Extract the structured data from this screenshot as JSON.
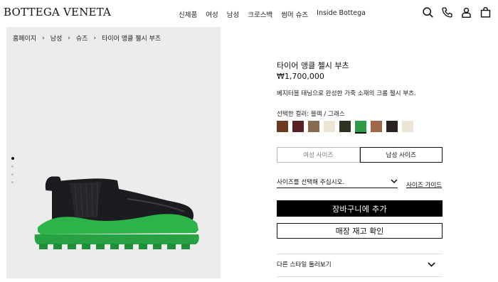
{
  "header": {
    "logo": "BOTTEGA VENETA",
    "nav": [
      "신제품",
      "여성",
      "남성",
      "크로스백",
      "썸머 슈즈",
      "Inside Bottega"
    ],
    "icons": [
      "search-icon",
      "phone-icon",
      "user-icon",
      "shopping-bag-icon"
    ]
  },
  "breadcrumb": [
    "홈페이지",
    "남성",
    "슈즈",
    "타이어 앵클 첼시 부츠"
  ],
  "product": {
    "title": "타이어 앵클 첼시 부츠",
    "price": "₩1,700,000",
    "description": "베지터블 태닝으로 완성한 가죽 소재의 크롬 첼시 부츠.",
    "color_label": "선택한 컬러: 블랙 / 그래스",
    "swatches": [
      {
        "color": "#6b3a1f"
      },
      {
        "color": "#5a1f25"
      },
      {
        "color": "#8a6a4e"
      },
      {
        "color": "#ede5d6"
      },
      {
        "color": "#2b3323"
      },
      {
        "color": "#2f9a4a",
        "selected": true
      },
      {
        "color": "#a0674a"
      },
      {
        "color": "#2a2221"
      },
      {
        "color": "#ede5d6"
      }
    ]
  },
  "size": {
    "tabs": [
      "여성 사이즈",
      "남성 사이즈"
    ],
    "active_tab": "남성 사이즈",
    "select_placeholder": "사이즈를 선택해 주십시오.",
    "guide": "사이즈 가이드"
  },
  "actions": {
    "add_to_cart": "장바구니에 추가",
    "check_stock": "매장 재고 확인"
  },
  "more_styles": "다른 스타일 둘러보기",
  "carousel": {
    "count": 4,
    "active": 1
  },
  "colors": {
    "boot_green": "#2cb34a",
    "boot_black": "#1c1c20",
    "image_bg": "#ececec"
  }
}
